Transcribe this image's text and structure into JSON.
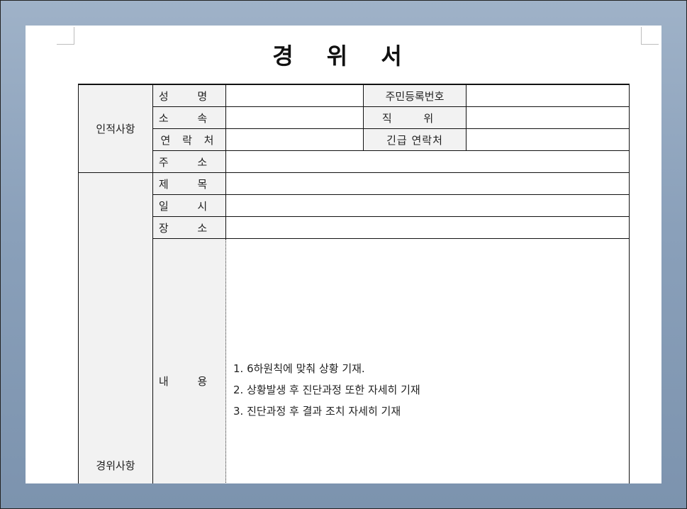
{
  "document": {
    "title": "경 위 서"
  },
  "sections": {
    "personal": "인적사항",
    "incident": "경위사항"
  },
  "labels": {
    "name": "성 명",
    "resident_id": "주민등록번호",
    "affiliation": "소 속",
    "position": "직 위",
    "contact": "연 락 처",
    "emergency_contact": "긴급 연락처",
    "address": "주 소",
    "subject": "제 목",
    "datetime": "일 시",
    "place": "장 소",
    "content": "내 용"
  },
  "content_lines": [
    "1. 6하원칙에 맞춰 상황 기재.",
    "2. 상황발생 후 진단과정 또한 자세히 기재",
    "3. 진단과정 후 결과 조치 자세히 기재"
  ]
}
